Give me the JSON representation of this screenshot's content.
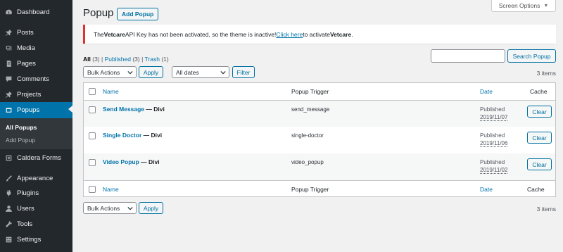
{
  "sidebar": {
    "items": [
      {
        "label": "Dashboard",
        "icon": "dashboard-icon"
      },
      {
        "label": "Posts",
        "icon": "pin-icon"
      },
      {
        "label": "Media",
        "icon": "media-icon"
      },
      {
        "label": "Pages",
        "icon": "page-icon"
      },
      {
        "label": "Comments",
        "icon": "comment-icon"
      },
      {
        "label": "Projects",
        "icon": "pin-icon"
      },
      {
        "label": "Popups",
        "icon": "popup-icon"
      },
      {
        "label": "Caldera Forms",
        "icon": "form-icon"
      },
      {
        "label": "Appearance",
        "icon": "brush-icon"
      },
      {
        "label": "Plugins",
        "icon": "plugin-icon"
      },
      {
        "label": "Users",
        "icon": "user-icon"
      },
      {
        "label": "Tools",
        "icon": "wrench-icon"
      },
      {
        "label": "Settings",
        "icon": "settings-icon"
      }
    ],
    "submenu": [
      "All Popups",
      "Add Popup"
    ]
  },
  "screen_options": "Screen Options",
  "title": "Popup",
  "add_button": "Add Popup",
  "notice": {
    "text1": "The ",
    "bold1": "Vetcare",
    "text2": " API Key has not been activated, so the theme is inactive! ",
    "link": "Click here",
    "text3": " to activate ",
    "bold2": "Vetcare",
    "text4": "."
  },
  "filters": {
    "all": "All",
    "all_count": "(3)",
    "sep": "|",
    "published": "Published",
    "published_count": "(3)",
    "trash": "Trash",
    "trash_count": "(1)"
  },
  "search_button": "Search Popup",
  "bulk_actions": "Bulk Actions",
  "apply": "Apply",
  "all_dates": "All dates",
  "filter": "Filter",
  "items_count": "3 items",
  "columns": {
    "name": "Name",
    "trigger": "Popup Trigger",
    "date": "Date",
    "cache": "Cache"
  },
  "rows": [
    {
      "title": "Send Message",
      "state": " — Divi",
      "trigger": "send_message",
      "status": "Published",
      "date": "2019/11/07",
      "clear": "Clear"
    },
    {
      "title": "Single Doctor",
      "state": " — Divi",
      "trigger": "single-doctor",
      "status": "Published",
      "date": "2019/11/06",
      "clear": "Clear"
    },
    {
      "title": "Video Popup",
      "state": " — Divi",
      "trigger": "video_popup",
      "status": "Published",
      "date": "2019/11/02",
      "clear": "Clear"
    }
  ]
}
